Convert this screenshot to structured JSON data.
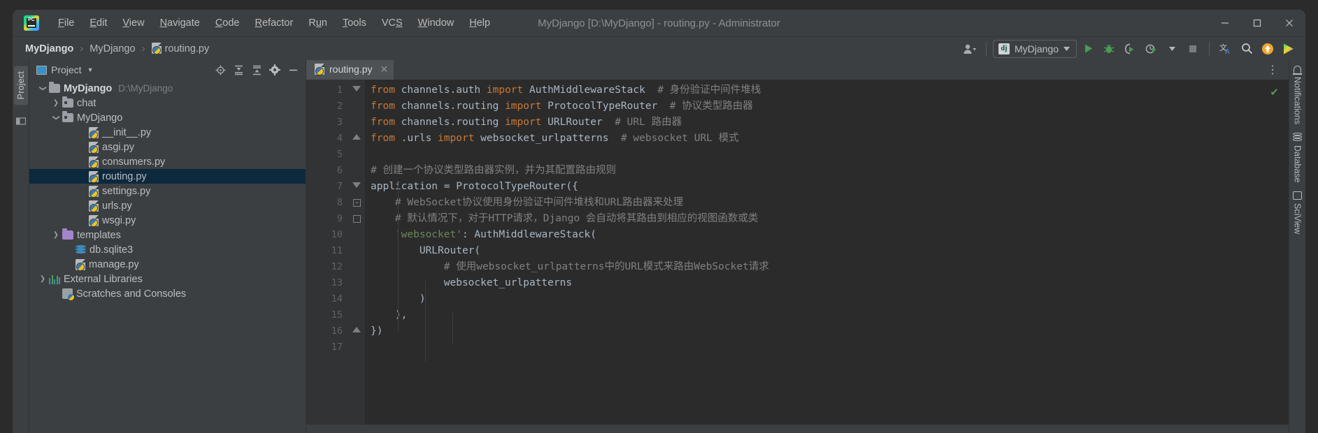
{
  "window": {
    "title": "MyDjango [D:\\MyDjango] - routing.py - Administrator",
    "app_logo_text": "PC",
    "controls": {
      "minimize": "—",
      "maximize": "☐",
      "close": "✕"
    }
  },
  "menubar": {
    "items": [
      {
        "label": "File",
        "mnemonic": "F"
      },
      {
        "label": "Edit",
        "mnemonic": "E"
      },
      {
        "label": "View",
        "mnemonic": "V"
      },
      {
        "label": "Navigate",
        "mnemonic": "N"
      },
      {
        "label": "Code",
        "mnemonic": "C"
      },
      {
        "label": "Refactor",
        "mnemonic": "R"
      },
      {
        "label": "Run",
        "mnemonic": "u"
      },
      {
        "label": "Tools",
        "mnemonic": "T"
      },
      {
        "label": "VCS",
        "mnemonic": "S"
      },
      {
        "label": "Window",
        "mnemonic": "W"
      },
      {
        "label": "Help",
        "mnemonic": "H"
      }
    ]
  },
  "breadcrumb": {
    "items": [
      "MyDjango",
      "MyDjango",
      "routing.py"
    ],
    "separator": "›"
  },
  "toolbar": {
    "run_config_label": "MyDjango",
    "run_config_badge": "dj",
    "icons": [
      "user-account-icon",
      "run-icon",
      "debug-icon",
      "coverage-icon",
      "profiler-icon",
      "stop-icon",
      "translate-icon",
      "search-everywhere-icon",
      "update-project-icon",
      "ide-assistant-icon"
    ]
  },
  "left_strip": {
    "project_tab": "Project"
  },
  "project_panel": {
    "title": "Project",
    "header_icons": [
      "locate-icon",
      "expand-all-icon",
      "collapse-all-icon",
      "settings-icon",
      "hide-icon"
    ],
    "tree": [
      {
        "depth": 0,
        "arrow": "down",
        "icon": "folder",
        "label": "MyDjango",
        "bold": true,
        "path": "D:\\MyDjango",
        "selected": false
      },
      {
        "depth": 1,
        "arrow": "right",
        "icon": "folder-module",
        "label": "chat",
        "bold": false,
        "path": "",
        "selected": false
      },
      {
        "depth": 1,
        "arrow": "down",
        "icon": "folder-module",
        "label": "MyDjango",
        "bold": false,
        "path": "",
        "selected": false
      },
      {
        "depth": 3,
        "arrow": "none",
        "icon": "python-file",
        "label": "__init__.py",
        "bold": false,
        "path": "",
        "selected": false
      },
      {
        "depth": 3,
        "arrow": "none",
        "icon": "python-file",
        "label": "asgi.py",
        "bold": false,
        "path": "",
        "selected": false
      },
      {
        "depth": 3,
        "arrow": "none",
        "icon": "python-file",
        "label": "consumers.py",
        "bold": false,
        "path": "",
        "selected": false
      },
      {
        "depth": 3,
        "arrow": "none",
        "icon": "python-file",
        "label": "routing.py",
        "bold": false,
        "path": "",
        "selected": true
      },
      {
        "depth": 3,
        "arrow": "none",
        "icon": "python-file",
        "label": "settings.py",
        "bold": false,
        "path": "",
        "selected": false
      },
      {
        "depth": 3,
        "arrow": "none",
        "icon": "python-file",
        "label": "urls.py",
        "bold": false,
        "path": "",
        "selected": false
      },
      {
        "depth": 3,
        "arrow": "none",
        "icon": "python-file",
        "label": "wsgi.py",
        "bold": false,
        "path": "",
        "selected": false
      },
      {
        "depth": 1,
        "arrow": "right",
        "icon": "folder-purple",
        "label": "templates",
        "bold": false,
        "path": "",
        "selected": false
      },
      {
        "depth": 2,
        "arrow": "none",
        "icon": "database-file",
        "label": "db.sqlite3",
        "bold": false,
        "path": "",
        "selected": false
      },
      {
        "depth": 2,
        "arrow": "none",
        "icon": "python-file",
        "label": "manage.py",
        "bold": false,
        "path": "",
        "selected": false
      },
      {
        "depth": 0,
        "arrow": "right",
        "icon": "library",
        "label": "External Libraries",
        "bold": false,
        "path": "",
        "selected": false
      },
      {
        "depth": 1,
        "arrow": "none",
        "icon": "scratch",
        "label": "Scratches and Consoles",
        "bold": false,
        "path": "",
        "selected": false
      }
    ]
  },
  "editor": {
    "tab": {
      "label": "routing.py",
      "icon": "python-file-icon",
      "close": "✕"
    },
    "overflow_icon": "more-options-icon",
    "inspection_status": "✔",
    "lines": [
      {
        "n": "1",
        "fold": "tri-down",
        "tokens": [
          {
            "t": "from ",
            "c": "kw"
          },
          {
            "t": "channels.auth ",
            "c": "plain"
          },
          {
            "t": "import ",
            "c": "kw"
          },
          {
            "t": "AuthMiddlewareStack  ",
            "c": "plain"
          },
          {
            "t": "# 身份验证中间件堆栈",
            "c": "cmt"
          }
        ]
      },
      {
        "n": "2",
        "fold": "",
        "tokens": [
          {
            "t": "from ",
            "c": "kw"
          },
          {
            "t": "channels.routing ",
            "c": "plain"
          },
          {
            "t": "import ",
            "c": "kw"
          },
          {
            "t": "ProtocolTypeRouter  ",
            "c": "plain"
          },
          {
            "t": "# 协议类型路由器",
            "c": "cmt"
          }
        ]
      },
      {
        "n": "3",
        "fold": "",
        "tokens": [
          {
            "t": "from ",
            "c": "kw"
          },
          {
            "t": "channels.routing ",
            "c": "plain"
          },
          {
            "t": "import ",
            "c": "kw"
          },
          {
            "t": "URLRouter  ",
            "c": "plain"
          },
          {
            "t": "# URL 路由器",
            "c": "cmt"
          }
        ]
      },
      {
        "n": "4",
        "fold": "tri-up",
        "tokens": [
          {
            "t": "from ",
            "c": "kw"
          },
          {
            "t": ".urls ",
            "c": "plain"
          },
          {
            "t": "import ",
            "c": "kw"
          },
          {
            "t": "websocket_urlpatterns  ",
            "c": "plain"
          },
          {
            "t": "# websocket URL 模式",
            "c": "cmt"
          }
        ]
      },
      {
        "n": "5",
        "fold": "",
        "tokens": []
      },
      {
        "n": "6",
        "fold": "",
        "tokens": [
          {
            "t": "# 创建一个协议类型路由器实例，并为其配置路由规则",
            "c": "cmt"
          }
        ]
      },
      {
        "n": "7",
        "fold": "tri-down",
        "tokens": [
          {
            "t": "application ",
            "c": "plain"
          },
          {
            "t": "= ",
            "c": "plain"
          },
          {
            "t": "ProtocolTypeRouter({",
            "c": "plain"
          }
        ]
      },
      {
        "n": "8",
        "fold": "box-minus",
        "tokens": [
          {
            "t": "    # WebSocket协议使用身份验证中间件堆栈和URL路由器来处理",
            "c": "cmt"
          }
        ]
      },
      {
        "n": "9",
        "fold": "box-up",
        "tokens": [
          {
            "t": "    # 默认情况下，对于HTTP请求，Django 会自动将其路由到相应的视图函数或类",
            "c": "cmt"
          }
        ]
      },
      {
        "n": "10",
        "fold": "",
        "tokens": [
          {
            "t": "    ",
            "c": "plain"
          },
          {
            "t": "'websocket'",
            "c": "str"
          },
          {
            "t": ": AuthMiddlewareStack(",
            "c": "plain"
          }
        ]
      },
      {
        "n": "11",
        "fold": "",
        "tokens": [
          {
            "t": "        URLRouter(",
            "c": "plain"
          }
        ]
      },
      {
        "n": "12",
        "fold": "",
        "tokens": [
          {
            "t": "            # 使用websocket_urlpatterns中的URL模式来路由WebSocket请求",
            "c": "cmt"
          }
        ]
      },
      {
        "n": "13",
        "fold": "",
        "tokens": [
          {
            "t": "            websocket_urlpatterns",
            "c": "plain"
          }
        ]
      },
      {
        "n": "14",
        "fold": "",
        "tokens": [
          {
            "t": "        )",
            "c": "plain"
          }
        ]
      },
      {
        "n": "15",
        "fold": "",
        "tokens": [
          {
            "t": "    ),",
            "c": "plain"
          }
        ]
      },
      {
        "n": "16",
        "fold": "tri-up",
        "tokens": [
          {
            "t": "})",
            "c": "plain"
          }
        ]
      },
      {
        "n": "17",
        "fold": "",
        "tokens": []
      }
    ]
  },
  "right_strip": {
    "items": [
      {
        "label": "Notifications",
        "icon": "bell-icon"
      },
      {
        "label": "Database",
        "icon": "database-icon"
      },
      {
        "label": "SciView",
        "icon": "sciview-icon"
      }
    ]
  },
  "colors": {
    "window_bg": "#3c3f41",
    "editor_bg": "#2b2b2b",
    "gutter_bg": "#313335",
    "selection": "#0d293e",
    "keyword": "#cc7832",
    "string": "#6a8759",
    "comment": "#808080",
    "text": "#a9b7c6",
    "accent_green": "#499c54"
  }
}
